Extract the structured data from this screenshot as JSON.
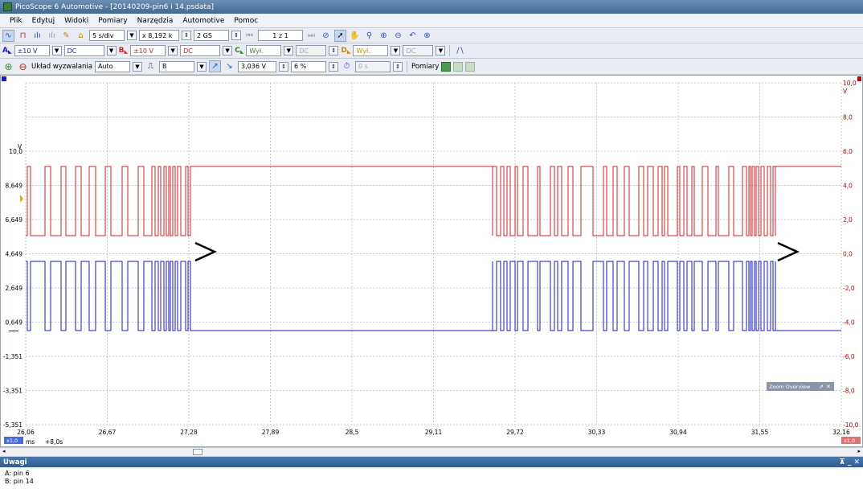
{
  "window": {
    "title": "PicoScope 6 Automotive - [20140209-pin6 i 14.psdata]"
  },
  "menu": [
    "Plik",
    "Edytuj",
    "Widoki",
    "Pomiary",
    "Narzędzia",
    "Automotive",
    "Pomoc"
  ],
  "toolbar1": {
    "timebase": "5 s/div",
    "multiplier": "x 8,192 k",
    "samples": "2 GS",
    "page": "1 z 1"
  },
  "channels": {
    "a": {
      "label": "A",
      "range": "±10 V",
      "coupling": "DC"
    },
    "b": {
      "label": "B",
      "range": "±10 V",
      "coupling": "DC"
    },
    "c": {
      "label": "C",
      "state": "Wył.",
      "coupling": "DC"
    },
    "d": {
      "label": "D",
      "state": "Wył.",
      "coupling": "DC"
    }
  },
  "trigger": {
    "label": "Układ wyzwalania",
    "mode": "Auto",
    "source": "B",
    "level": "3,036 V",
    "pre_trigger": "6 %",
    "delay": "0 s",
    "measurements_label": "Pomiary"
  },
  "plot": {
    "left_axis_unit": "V",
    "left_ticks": [
      "10,0",
      "8,649",
      "6,649",
      "4,649",
      "2,649",
      "0,649",
      "-1,351",
      "-3,351",
      "-5,351"
    ],
    "right_axis_unit": "V",
    "right_ticks": [
      "10,0",
      "8,0",
      "6,0",
      "4,0",
      "2,0",
      "0,0",
      "-2,0",
      "-4,0",
      "-6,0",
      "-8,0",
      "-10,0"
    ],
    "x_ticks": [
      "26,06",
      "26,67",
      "27,28",
      "27,89",
      "28,5",
      "29,11",
      "29,72",
      "30,33",
      "30,94",
      "31,55",
      "32,16"
    ],
    "x_unit": "ms",
    "x_offset": "+8,0s",
    "zoom_left": "x1,0",
    "zoom_right": "x1,0",
    "zoom_overview": "Zoom Overview",
    "colors": {
      "channel_a": "#d42020",
      "channel_b": "#1a1ac8",
      "grid": "#c9c9c9"
    }
  },
  "notes": {
    "title": "Uwagi",
    "lines": [
      "A: pin 6",
      "B: pin 14"
    ]
  }
}
